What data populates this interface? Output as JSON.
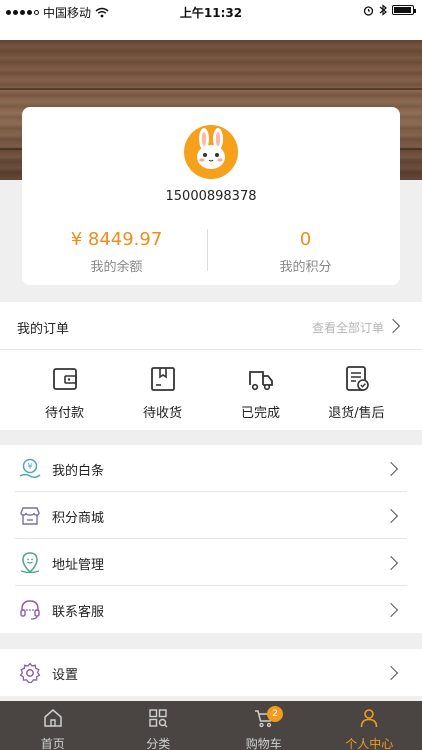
{
  "status_bar": {
    "carrier": "中国移动",
    "time": "上午11:32"
  },
  "profile": {
    "phone": "15000898378",
    "balance_value": "¥ 8449.97",
    "balance_label": "我的余额",
    "points_value": "0",
    "points_label": "我的积分"
  },
  "orders": {
    "title": "我的订单",
    "view_all": "查看全部订单",
    "items": [
      {
        "label": "待付款",
        "icon": "wallet-icon"
      },
      {
        "label": "待收货",
        "icon": "package-icon"
      },
      {
        "label": "已完成",
        "icon": "truck-icon"
      },
      {
        "label": "退货/售后",
        "icon": "refund-document-icon"
      }
    ]
  },
  "menu": {
    "items": [
      {
        "label": "我的白条",
        "icon": "credit-coin-icon"
      },
      {
        "label": "积分商城",
        "icon": "store-icon"
      },
      {
        "label": "地址管理",
        "icon": "location-pin-icon"
      },
      {
        "label": "联系客服",
        "icon": "headset-icon"
      }
    ],
    "settings_label": "设置"
  },
  "tabbar": {
    "items": [
      {
        "label": "首页",
        "icon": "home-icon"
      },
      {
        "label": "分类",
        "icon": "category-grid-icon"
      },
      {
        "label": "购物车",
        "icon": "cart-icon"
      },
      {
        "label": "个人中心",
        "icon": "person-icon"
      }
    ],
    "cart_badge": "2",
    "active_color": "#f29c1f",
    "bar_color": "#4a4542"
  },
  "colors": {
    "accent": "#f08c1a",
    "avatar_bg": "#f6a11b"
  }
}
